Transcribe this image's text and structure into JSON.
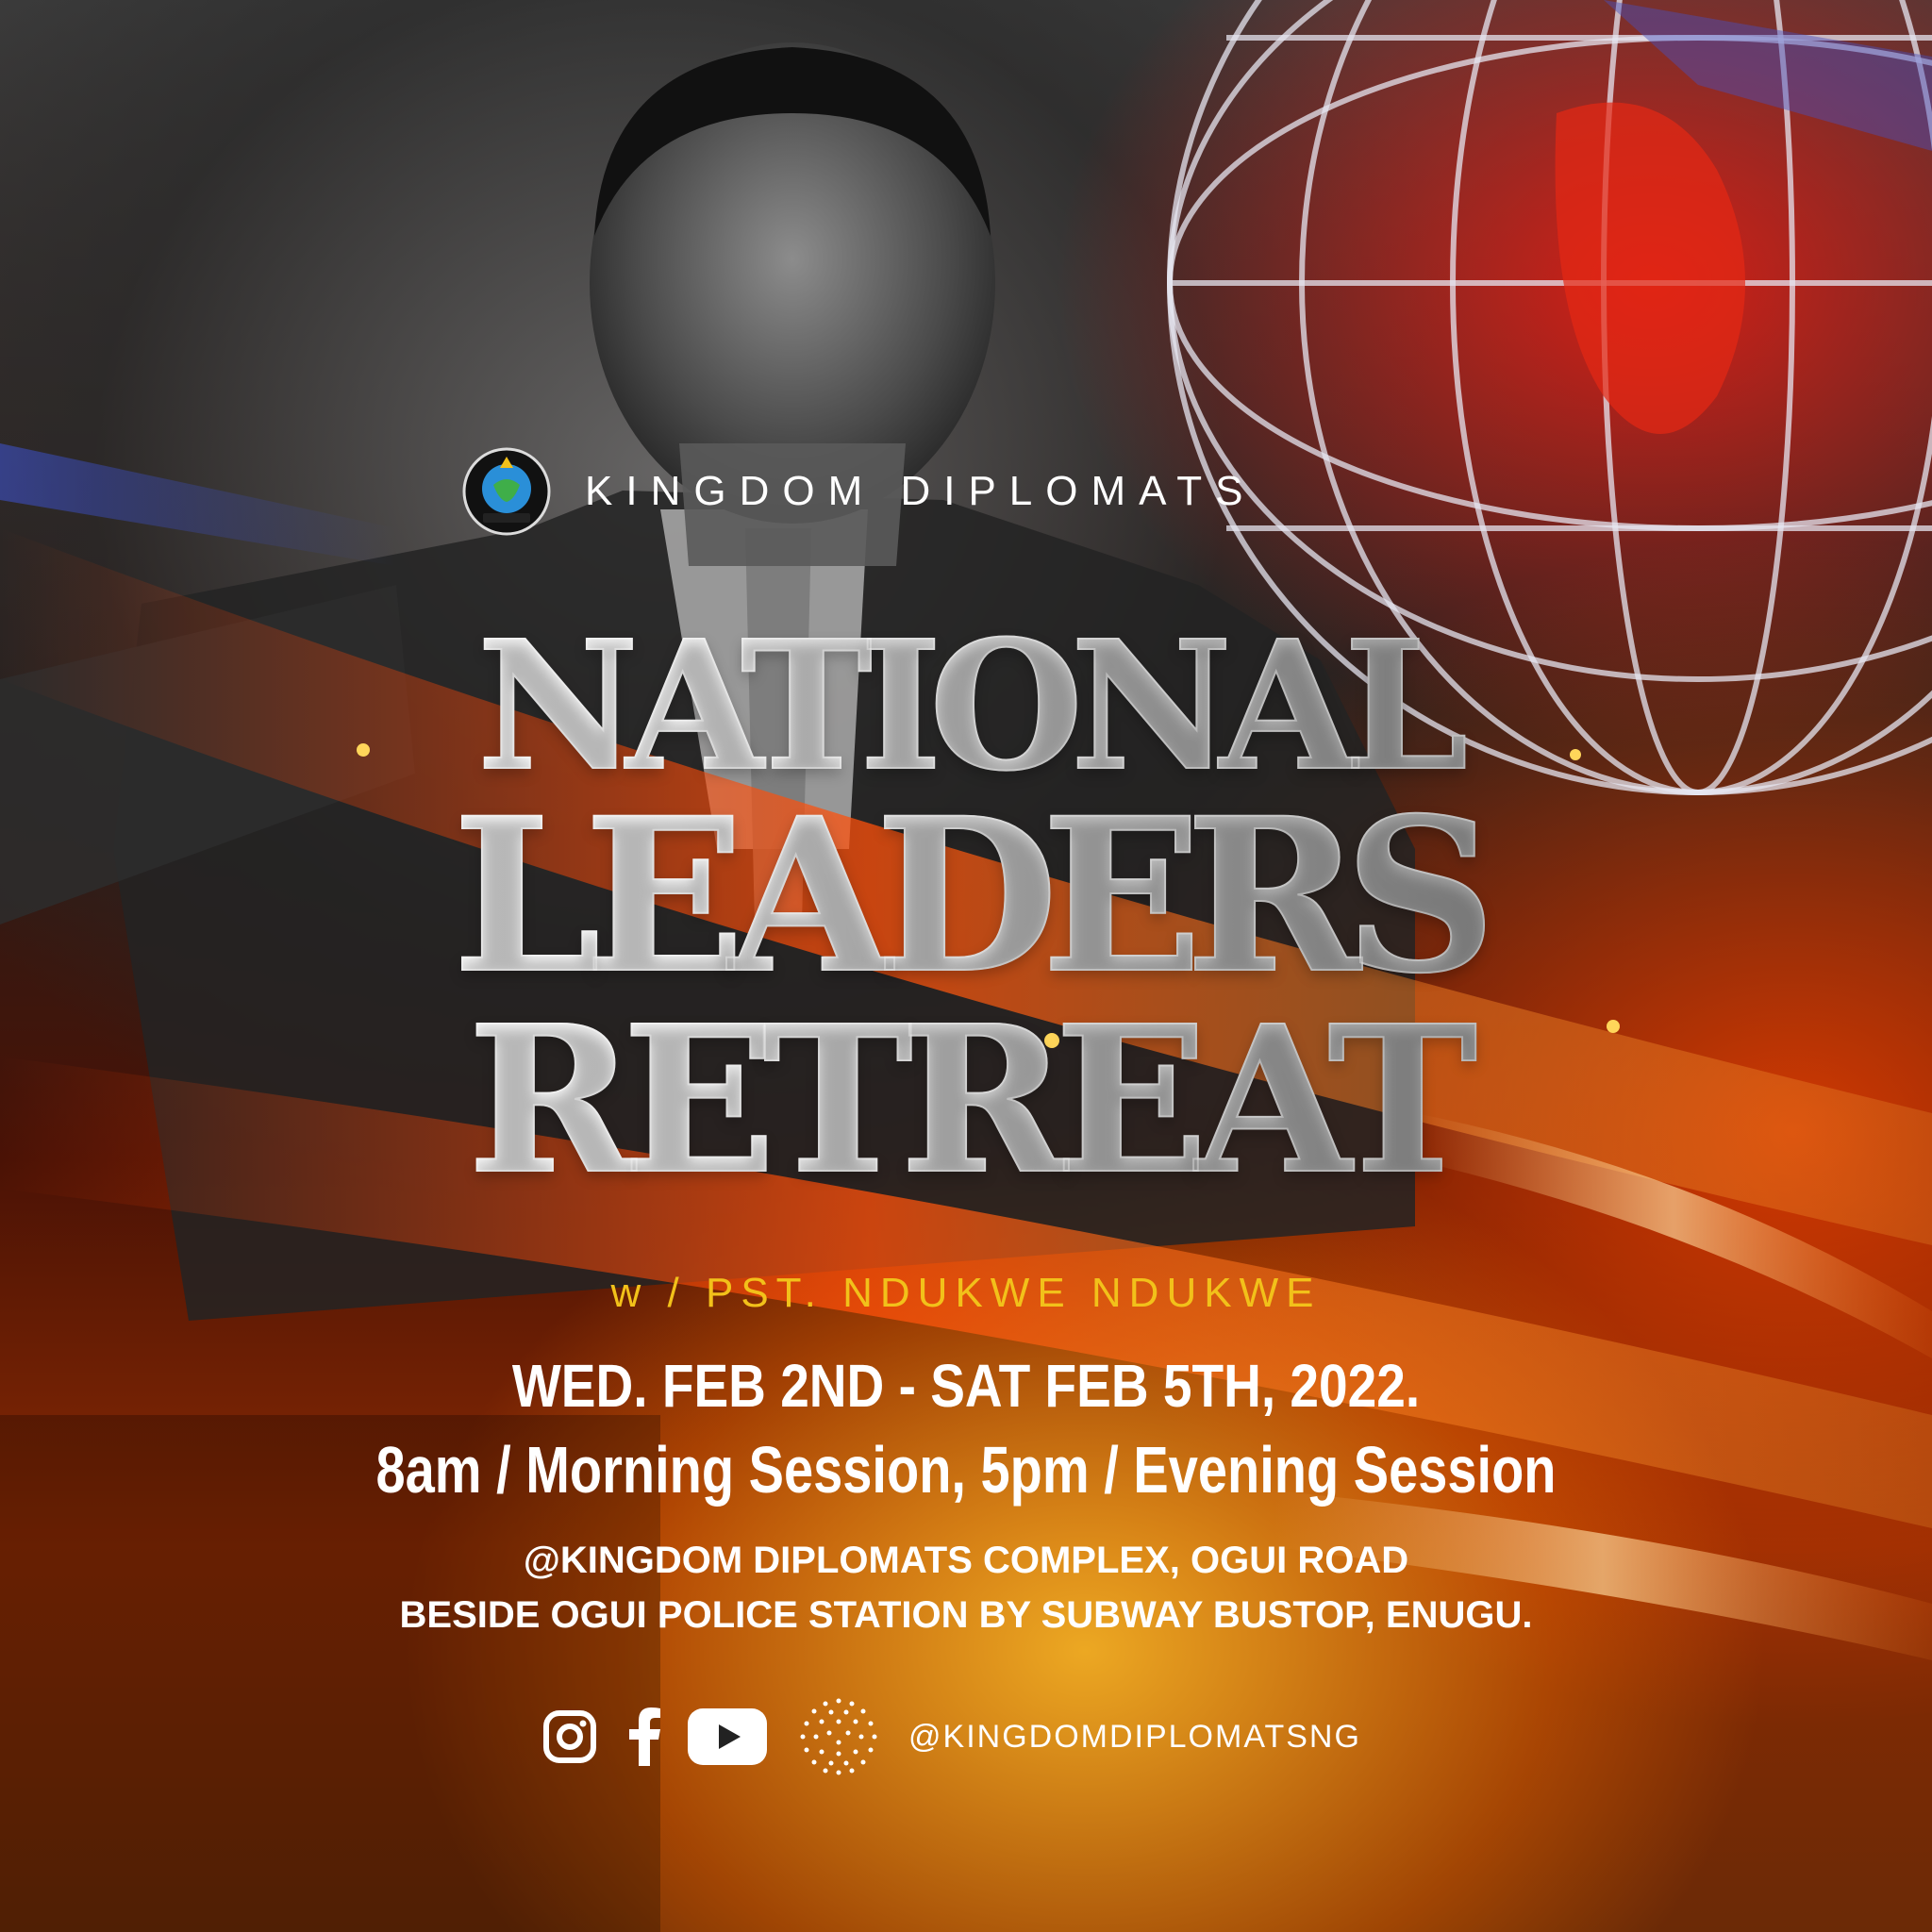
{
  "brand": {
    "name": "KINGDOM DIPLOMATS",
    "logo_icon": "kingdom-diplomats-seal-icon",
    "logo_text": "KINGDOM DIPLOMATS"
  },
  "title": {
    "line1": "NATIONAL",
    "line2": "LEADERS",
    "line3": "RETREAT"
  },
  "host": "w / PST. NDUKWE NDUKWE",
  "event": {
    "dates": "WED. FEB 2ND - SAT FEB 5TH, 2022.",
    "sessions": "8am / Morning Session, 5pm / Evening Session"
  },
  "venue": {
    "line1": "@KINGDOM DIPLOMATS COMPLEX, OGUI ROAD",
    "line2": "BESIDE OGUI POLICE STATION BY SUBWAY BUSTOP, ENUGU."
  },
  "social": {
    "icons": [
      "instagram-icon",
      "facebook-icon",
      "youtube-icon",
      "dotted-globe-icon"
    ],
    "handle": "@KINGDOMDIPLOMATSNG"
  },
  "colors": {
    "accent_gold": "#f2c11a",
    "fire_red": "#e8301a",
    "fire_orange": "#ff7a00",
    "text_white": "#ffffff"
  }
}
